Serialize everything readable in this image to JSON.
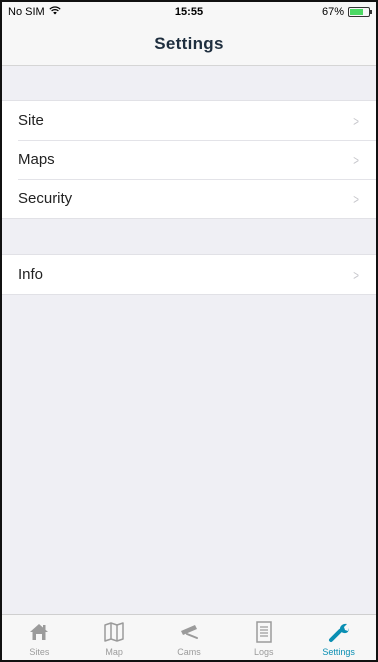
{
  "status": {
    "carrier": "No SIM",
    "time": "15:55",
    "battery": "67%"
  },
  "header": {
    "title": "Settings"
  },
  "groups": [
    {
      "items": [
        {
          "label": "Site"
        },
        {
          "label": "Maps"
        },
        {
          "label": "Security"
        }
      ]
    },
    {
      "items": [
        {
          "label": "Info"
        }
      ]
    }
  ],
  "tabs": [
    {
      "label": "Sites",
      "icon": "home-icon"
    },
    {
      "label": "Map",
      "icon": "map-icon"
    },
    {
      "label": "Cams",
      "icon": "camera-icon"
    },
    {
      "label": "Logs",
      "icon": "list-icon"
    },
    {
      "label": "Settings",
      "icon": "wrench-icon"
    }
  ],
  "colors": {
    "accent": "#0a8fb3",
    "battery": "#4cd964",
    "background": "#efeff4"
  }
}
